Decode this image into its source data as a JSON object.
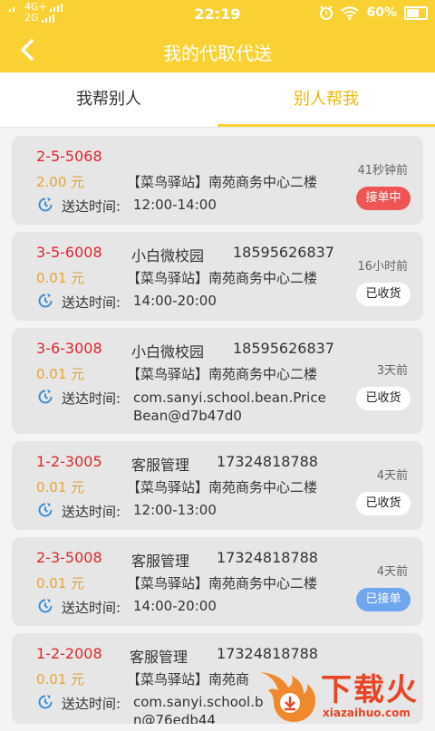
{
  "status_bar": {
    "network_top": "4G+",
    "network_bottom": "2G",
    "time": "22:19",
    "battery": "60%"
  },
  "header": {
    "title": "我的代取代送",
    "back_icon": "chevron-left-icon"
  },
  "tabs": [
    {
      "label": "我帮别人",
      "active": false
    },
    {
      "label": "别人帮我",
      "active": true
    }
  ],
  "colors": {
    "accent": "#f9d133",
    "code": "#e0262b",
    "price": "#e8a238",
    "badge_red": "#ee5554",
    "badge_blue": "#6ea6ef"
  },
  "orders": [
    {
      "code": "2-5-5068",
      "name": "",
      "phone": "",
      "price": "2.00 元",
      "station": "【菜鸟驿站】南苑商务中心二楼",
      "time_label": "送达时间:",
      "time": "12:00-14:00",
      "ago": "41秒钟前",
      "status": "接单中"
    },
    {
      "code": "3-5-6008",
      "name": "小白微校园",
      "phone": "18595626837",
      "price": "0.01 元",
      "station": "【菜鸟驿站】南苑商务中心二楼",
      "time_label": "送达时间:",
      "time": "14:00-20:00",
      "ago": "16小时前",
      "status": "已收货"
    },
    {
      "code": "3-6-3008",
      "name": "小白微校园",
      "phone": "18595626837",
      "price": "0.01 元",
      "station": "【菜鸟驿站】南苑商务中心二楼",
      "time_label": "送达时间:",
      "time": "com.sanyi.school.bean.PriceBean@d7b47d0",
      "ago": "3天前",
      "status": "已收货"
    },
    {
      "code": "1-2-3005",
      "name": "客服管理",
      "phone": "17324818788",
      "price": "0.01 元",
      "station": "【菜鸟驿站】南苑商务中心二楼",
      "time_label": "送达时间:",
      "time": "12:00-13:00",
      "ago": "4天前",
      "status": "已收货"
    },
    {
      "code": "2-3-5008",
      "name": "客服管理",
      "phone": "17324818788",
      "price": "0.01 元",
      "station": "【菜鸟驿站】南苑商务中心二楼",
      "time_label": "送达时间:",
      "time": "14:00-20:00",
      "ago": "4天前",
      "status": "已接单"
    },
    {
      "code": "1-2-2008",
      "name": "客服管理",
      "phone": "17324818788",
      "price": "0.01 元",
      "station": "【菜鸟驿站】南苑商",
      "time_label": "送达时间:",
      "time": "com.sanyi.school.b",
      "time_line2": "n@76edb44"
    }
  ],
  "watermark": {
    "text": "下载火",
    "url": "xiazaihuo.com"
  }
}
